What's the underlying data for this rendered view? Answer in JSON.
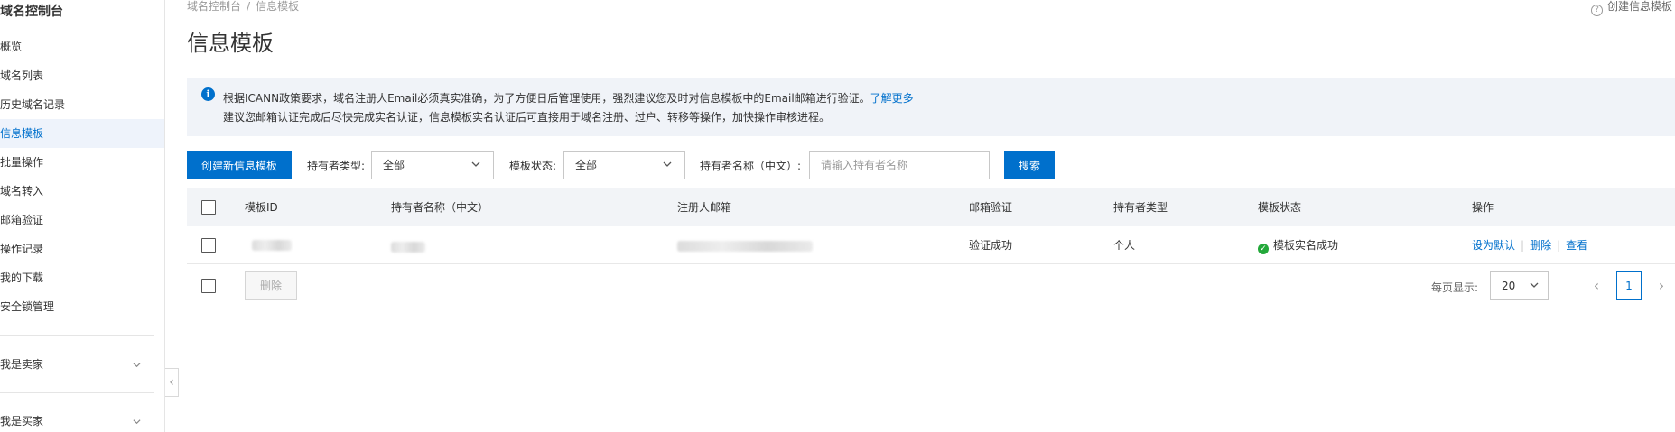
{
  "sidebar": {
    "title": "域名控制台",
    "items": [
      {
        "label": "概览"
      },
      {
        "label": "域名列表"
      },
      {
        "label": "历史域名记录"
      },
      {
        "label": "信息模板"
      },
      {
        "label": "批量操作"
      },
      {
        "label": "域名转入"
      },
      {
        "label": "邮箱验证"
      },
      {
        "label": "操作记录"
      },
      {
        "label": "我的下载"
      },
      {
        "label": "安全锁管理"
      }
    ],
    "active_index": 3,
    "groups": [
      {
        "label": "我是卖家"
      },
      {
        "label": "我是买家"
      }
    ],
    "collapse_glyph": "‹"
  },
  "breadcrumb": [
    "域名控制台",
    "/",
    "信息模板"
  ],
  "help_link": "创建信息模板",
  "page_title": "信息模板",
  "notice": {
    "line1": "根据ICANN政策要求，域名注册人Email必须真实准确，为了方便日后管理使用，强烈建议您及时对信息模板中的Email邮箱进行验证。",
    "link": "了解更多",
    "line2": "建议您邮箱认证完成后尽快完成实名认证，信息模板实名认证后可直接用于域名注册、过户、转移等操作，加快操作审核进程。"
  },
  "toolbar": {
    "create_button": "创建新信息模板",
    "holder_type_label": "持有者类型:",
    "holder_type_value": "全部",
    "status_label": "模板状态:",
    "status_value": "全部",
    "holder_name_label": "持有者名称（中文）:",
    "holder_name_placeholder": "请输入持有者名称",
    "search_button": "搜索"
  },
  "table": {
    "headers": [
      "模板ID",
      "持有者名称（中文）",
      "注册人邮箱",
      "邮箱验证",
      "持有者类型",
      "模板状态",
      "操作"
    ],
    "rows": [
      {
        "email_verify": "验证成功",
        "holder_type": "个人",
        "status": "模板实名成功",
        "actions": [
          "设为默认",
          "删除",
          "查看"
        ]
      }
    ]
  },
  "footer": {
    "delete_button": "删除",
    "page_size_label": "每页显示:",
    "page_size": "20",
    "current_page": "1",
    "prev_glyph": "‹",
    "next_glyph": "›"
  },
  "colors": {
    "accent": "#0070cc",
    "success": "#23a83a",
    "notice_bg": "#f0f3f8",
    "table_head_bg": "#f2f4f7"
  }
}
